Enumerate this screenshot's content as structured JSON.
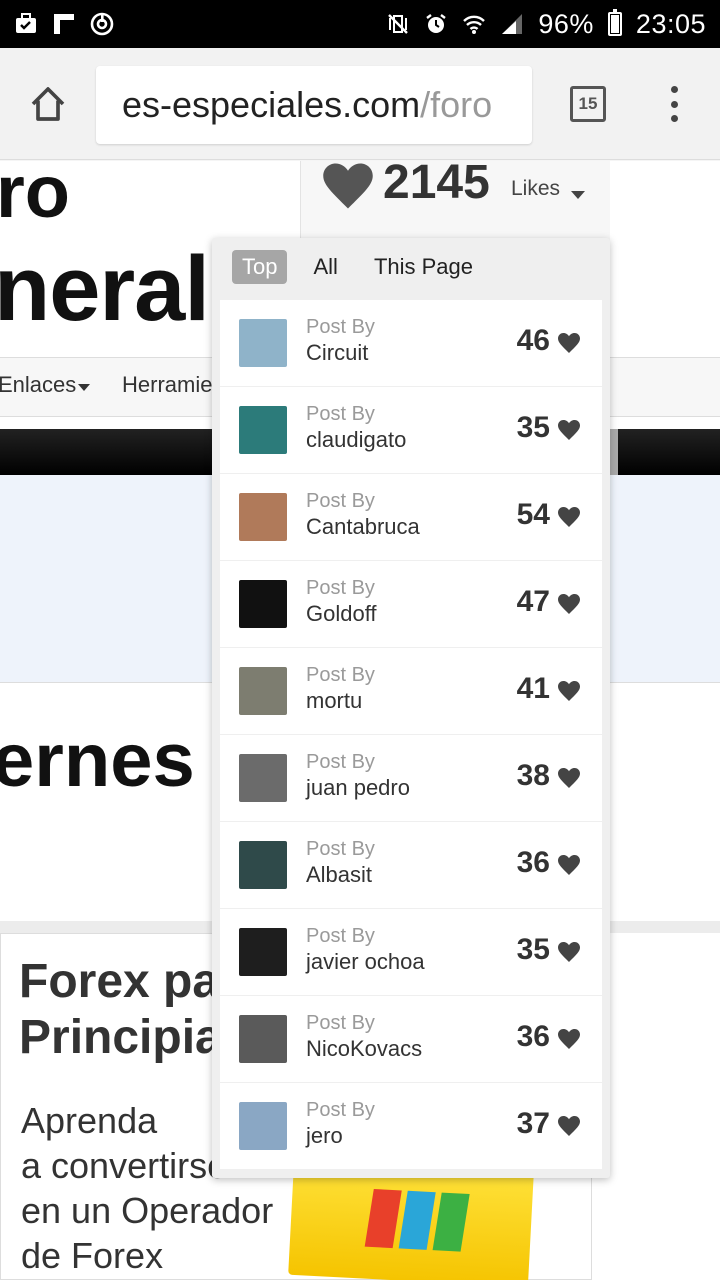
{
  "status_bar": {
    "battery": "96%",
    "time": "23:05"
  },
  "browser": {
    "url_host": "es-especiales.com",
    "url_path": "/foro",
    "tab_count": "15"
  },
  "page": {
    "title_line1": "ro",
    "title_line2": "neral",
    "likes_count": "2145",
    "likes_label": "Likes",
    "nav_enlaces": "Enlaces",
    "nav_herramientas": "Herramie",
    "big_text": "ernes",
    "ad": {
      "title_line1": "Forex par",
      "title_line2": "Principian",
      "sub_line1": "Aprenda",
      "sub_line2": "a convertirse",
      "sub_line3": "en un Operador",
      "sub_line4": "de Forex"
    }
  },
  "likes_dropdown": {
    "tabs": [
      {
        "label": "Top",
        "active": true
      },
      {
        "label": "All",
        "active": false
      },
      {
        "label": "This Page",
        "active": false
      }
    ],
    "post_by_label": "Post By",
    "items": [
      {
        "author": "Circuit",
        "count": "46",
        "avatar_color": "#8fb3c9"
      },
      {
        "author": "claudigato",
        "count": "35",
        "avatar_color": "#2c7b7a"
      },
      {
        "author": "Cantabruca",
        "count": "54",
        "avatar_color": "#b07a5a"
      },
      {
        "author": "Goldoff",
        "count": "47",
        "avatar_color": "#111111"
      },
      {
        "author": "mortu",
        "count": "41",
        "avatar_color": "#7d7d70"
      },
      {
        "author": "juan pedro",
        "count": "38",
        "avatar_color": "#6b6b6b"
      },
      {
        "author": "Albasit",
        "count": "36",
        "avatar_color": "#2f4a4a"
      },
      {
        "author": "javier ochoa",
        "count": "35",
        "avatar_color": "#1e1e1e"
      },
      {
        "author": "NicoKovacs",
        "count": "36",
        "avatar_color": "#5a5a5a"
      },
      {
        "author": "jero",
        "count": "37",
        "avatar_color": "#8aa7c4"
      }
    ]
  }
}
